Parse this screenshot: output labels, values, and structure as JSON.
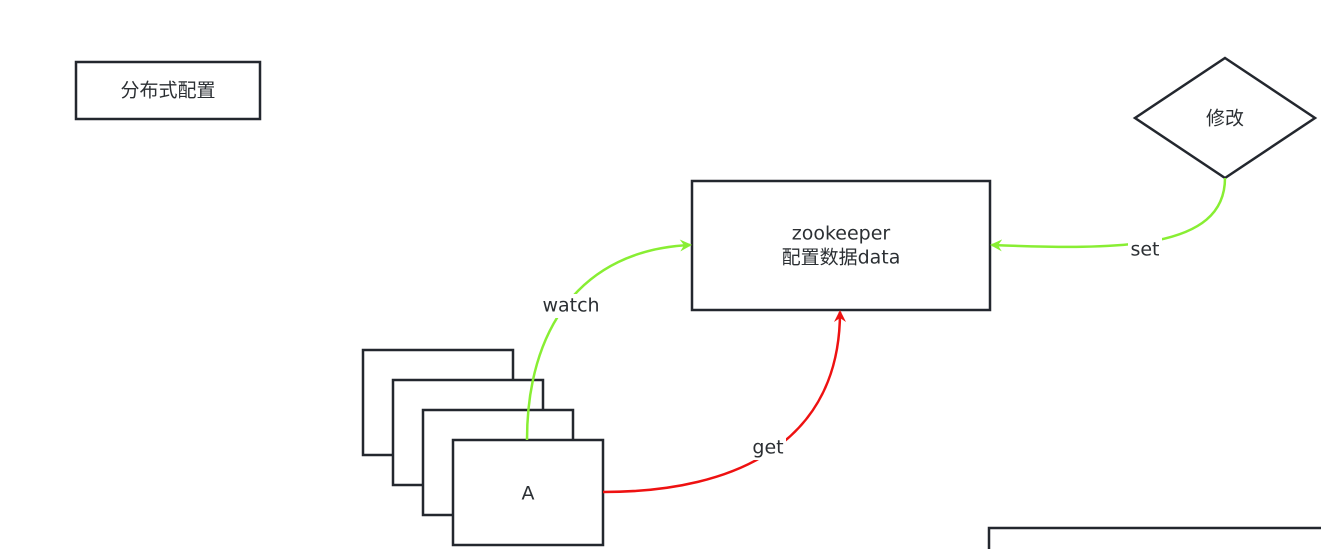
{
  "nodes": {
    "title": {
      "label": "分布式配置"
    },
    "zookeeper": {
      "line1": "zookeeper",
      "line2": "配置数据data"
    },
    "modify": {
      "label": "修改"
    },
    "client": {
      "label": "A"
    }
  },
  "edges": {
    "watch": {
      "label": "watch",
      "color": "#88ee33"
    },
    "get": {
      "label": "get",
      "color": "#ee1111"
    },
    "set": {
      "label": "set",
      "color": "#88ee33"
    }
  },
  "colors": {
    "stroke": "#23272e",
    "background": "#ffffff"
  }
}
